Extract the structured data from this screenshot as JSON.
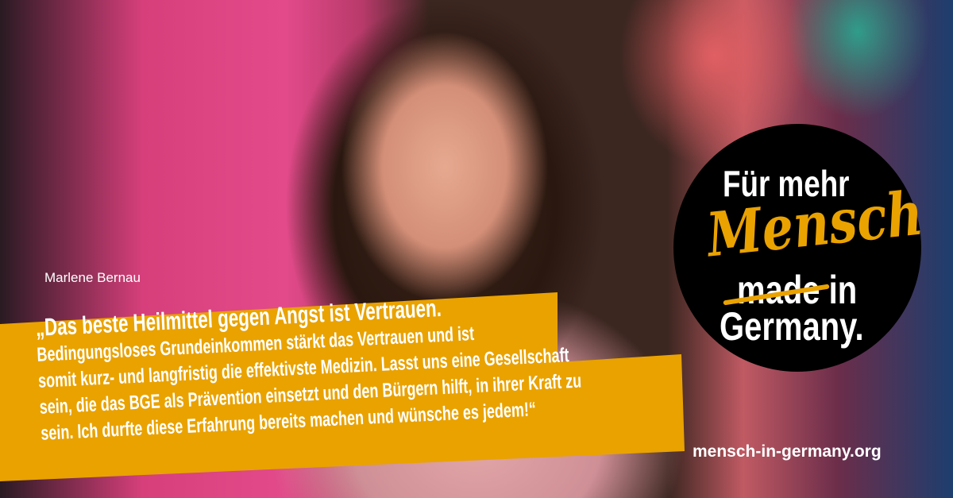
{
  "person_name": "Marlene Bernau",
  "quote": {
    "headline": "„Das beste Heilmittel gegen Angst ist Vertrauen.",
    "lines": [
      "Bedingungsloses Grundeinkommen stärkt das Vertrauen und ist",
      "somit kurz- und langfristig die effektivste Medizin. Lasst uns eine Gesellschaft",
      "sein, die das BGE als Prävention einsetzt und den Bürgern hilft, in ihrer Kraft zu",
      "sein. Ich durfte diese Erfahrung bereits machen und wünsche es jedem!“"
    ]
  },
  "badge": {
    "line1": "Für mehr",
    "handwritten": "Mensch",
    "struck": "made in",
    "line4": "Germany."
  },
  "website": "mensch-in-germany.org",
  "colors": {
    "accent": "#e9a200",
    "badge_bg": "#000000"
  }
}
